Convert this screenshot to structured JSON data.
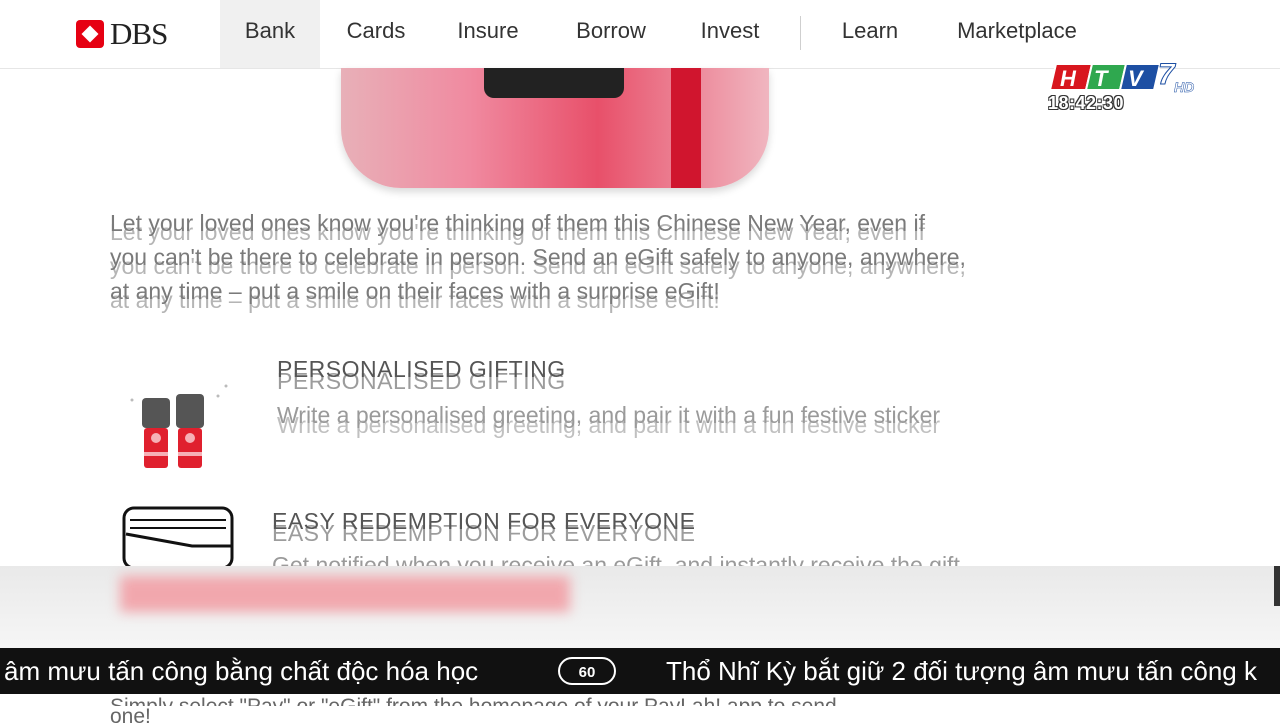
{
  "brand": {
    "name": "DBS"
  },
  "nav": {
    "items": [
      {
        "label": "Bank",
        "active": true
      },
      {
        "label": "Cards"
      },
      {
        "label": "Insure"
      },
      {
        "label": "Borrow"
      },
      {
        "label": "Invest"
      },
      {
        "label": "Learn"
      },
      {
        "label": "Marketplace"
      }
    ]
  },
  "intro": {
    "lines": [
      "Let your loved ones know you're thinking of them this Chinese New Year, even if",
      "you can't be there to celebrate in person. Send an eGift safely to anyone, anywhere,",
      "at any time – put a smile on their faces with a surprise eGift!"
    ]
  },
  "features": [
    {
      "title": "PERSONALISED GIFTING",
      "desc": "Write a personalised greeting, and pair it with a fun festive sticker",
      "icon": "lantern-icon"
    },
    {
      "title": "EASY REDEMPTION FOR EVERYONE",
      "desc": "Get notified when you receive an eGift, and instantly receive the gift",
      "icon": "wallet-icon"
    }
  ],
  "footer_text": {
    "line1": "Simply select \"Pay\" or \"eGift\" from the homepage of your PayLah! app to send",
    "line2": "one!"
  },
  "ticker": {
    "left": "âm mưu tấn công bằng chất độc hóa học",
    "logo": "60",
    "right": "Thổ Nhĩ Kỳ bắt giữ 2 đối tượng âm mưu tấn công k"
  },
  "channel": {
    "name": "HTV7",
    "suffix": "HD",
    "time": "18:42:30"
  },
  "colors": {
    "brand_red": "#e60012",
    "ticker_bg": "#111111"
  }
}
